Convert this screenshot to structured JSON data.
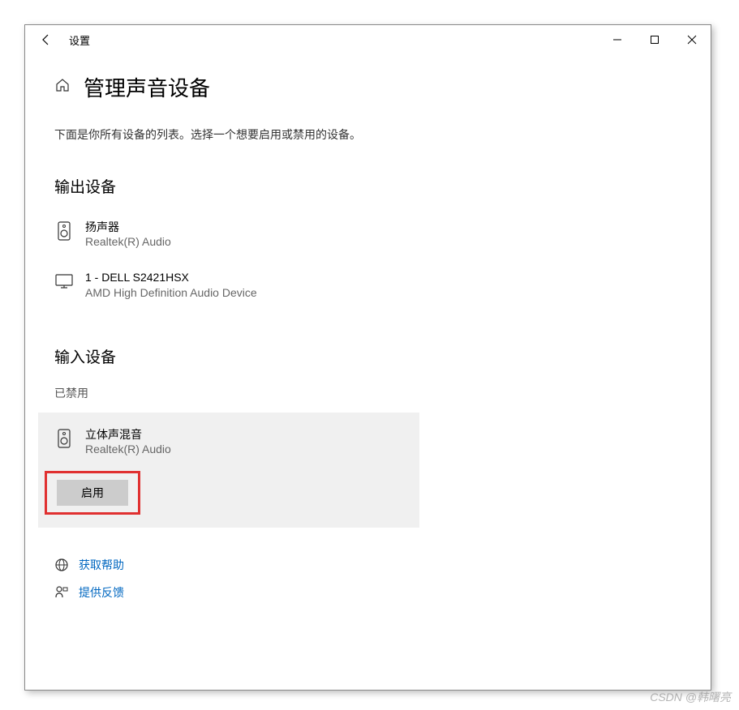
{
  "window": {
    "title": "设置"
  },
  "page": {
    "title": "管理声音设备",
    "description": "下面是你所有设备的列表。选择一个想要启用或禁用的设备。"
  },
  "output_section": {
    "title": "输出设备",
    "devices": [
      {
        "name": "扬声器",
        "sub": "Realtek(R) Audio"
      },
      {
        "name": "1 - DELL S2421HSX",
        "sub": "AMD High Definition Audio Device"
      }
    ]
  },
  "input_section": {
    "title": "输入设备",
    "disabled_label": "已禁用",
    "device": {
      "name": "立体声混音",
      "sub": "Realtek(R) Audio"
    },
    "enable_button": "启用"
  },
  "footer": {
    "help": "获取帮助",
    "feedback": "提供反馈"
  },
  "watermark": "CSDN @韩曙亮"
}
